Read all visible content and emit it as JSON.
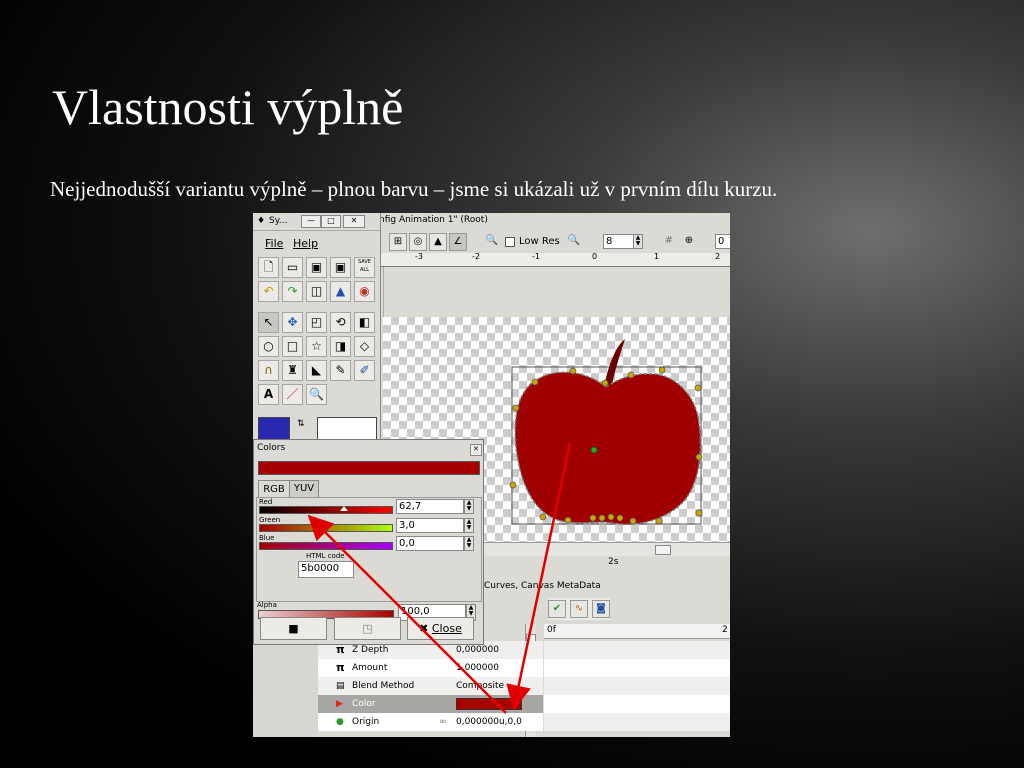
{
  "slide": {
    "title": "Vlastnosti výplně",
    "text": "Nejjednodušší variantu výplně – plnou barvu – jsme si ukázali už v prvním dílu kurzu."
  },
  "toolbox": {
    "title": "Sy...",
    "menu": {
      "file": "File",
      "help": "Help"
    },
    "save_all_label": "SAVE ALL"
  },
  "canvas": {
    "title": "nfig Animation 1\" (Root)",
    "low_res_label": "Low Res",
    "field_value": "8",
    "field2_value": "0",
    "ruler_labels": [
      "-3",
      "-2",
      "-1",
      "0",
      "1",
      "2"
    ],
    "time_label": "2s"
  },
  "colors_dialog": {
    "title": "Colors",
    "tab_rgb": "RGB",
    "tab_yuv": "YUV",
    "red_label": "Red",
    "red_value": "62,7",
    "green_label": "Green",
    "green_value": "3,0",
    "blue_label": "Blue",
    "blue_value": "0,0",
    "html_code_label": "HTML code",
    "html_code_value": "5b0000",
    "alpha_label": "Alpha",
    "alpha_value": "100,0",
    "close_label": "Close",
    "fill_color": "#a80000"
  },
  "params": {
    "tab_title": "Curves, Canvas MetaData",
    "timeline_start": "0f",
    "timeline_end": "2",
    "rows": [
      {
        "name": "Z Depth",
        "value": "0,000000"
      },
      {
        "name": "Amount",
        "value": "1,000000"
      },
      {
        "name": "Blend Method",
        "value": "Composite"
      },
      {
        "name": "Color",
        "value": ""
      },
      {
        "name": "Origin",
        "value": "0,000000u,0,0"
      }
    ]
  },
  "colors": {
    "apple": "#a00000",
    "selection": "#a8a6a2",
    "annotation_arrow": "#e00000"
  }
}
